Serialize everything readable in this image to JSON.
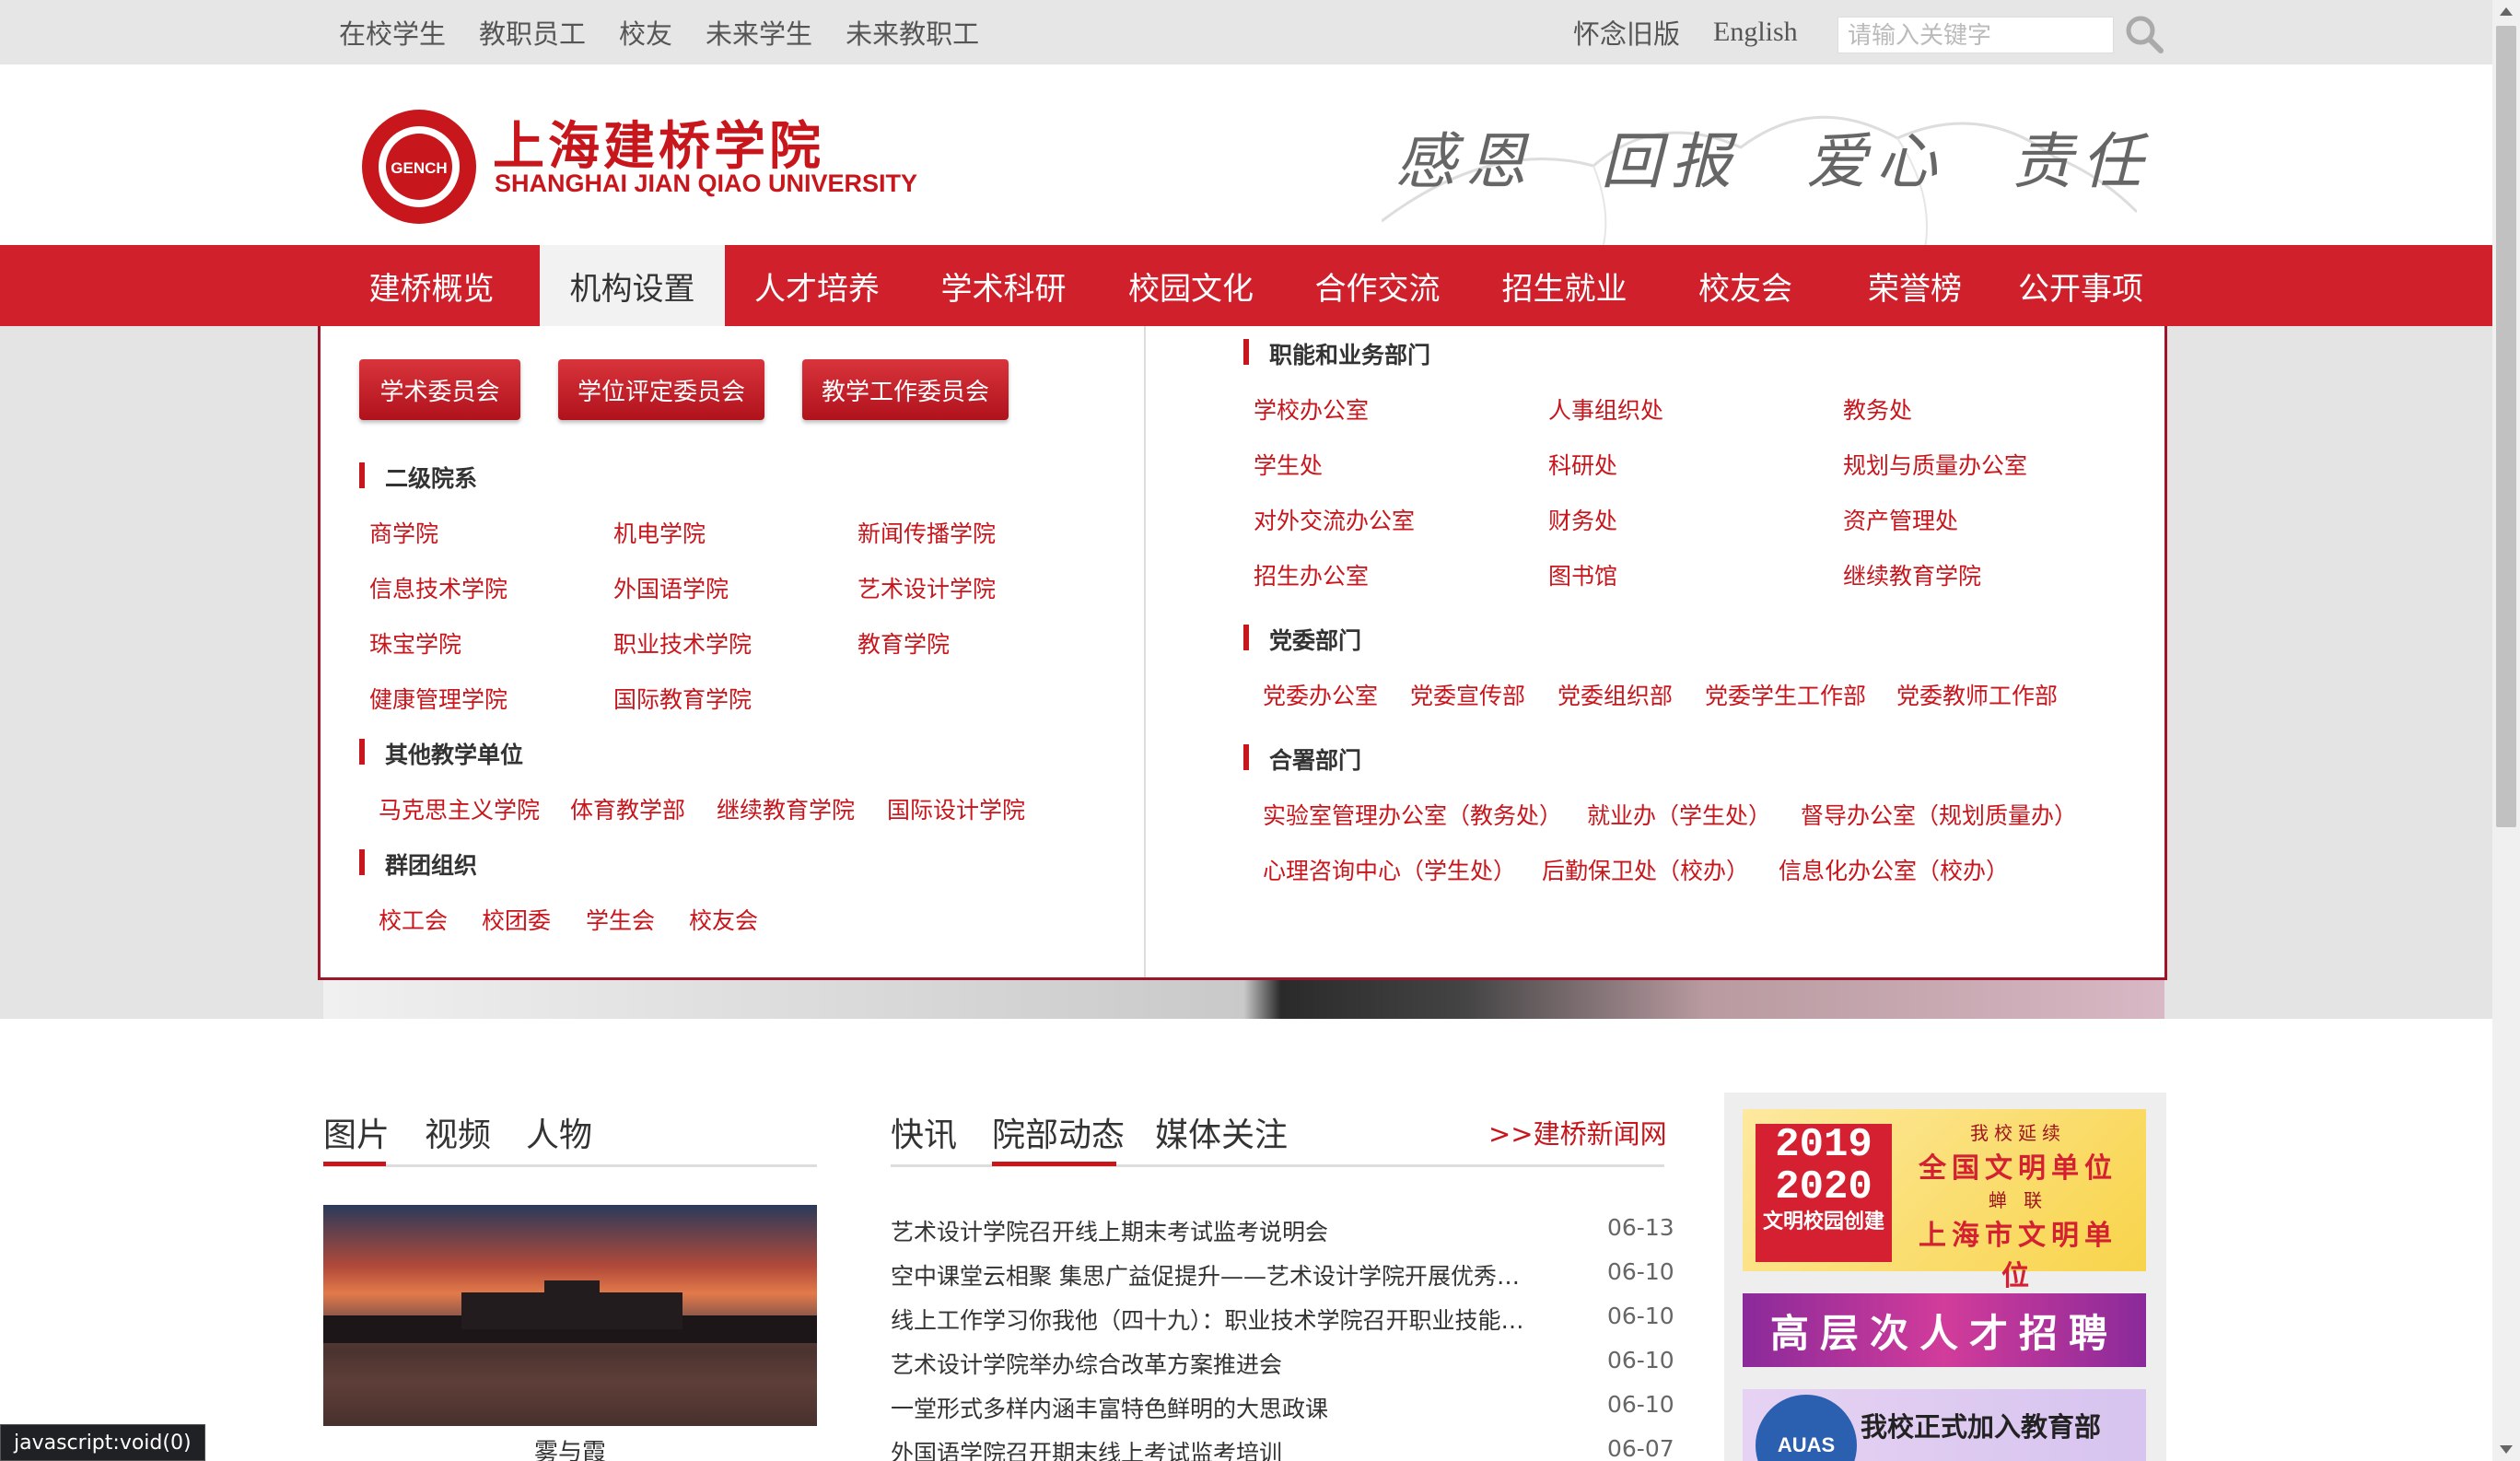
{
  "topbar": {
    "links": [
      "在校学生",
      "教职员工",
      "校友",
      "未来学生",
      "未来教职工"
    ],
    "old_version": "怀念旧版",
    "english": "English",
    "search_placeholder": "请输入关键字"
  },
  "header": {
    "logo_text": "GENCH",
    "cn_name": "上海建桥学院",
    "en_name": "SHANGHAI JIAN QIAO UNIVERSITY",
    "slogan": "感恩 回报 爱心 责任"
  },
  "nav": {
    "items": [
      "建桥概览",
      "机构设置",
      "人才培养",
      "学术科研",
      "校园文化",
      "合作交流",
      "招生就业",
      "校友会",
      "荣誉榜",
      "公开事项"
    ],
    "active": "机构设置"
  },
  "dropdown": {
    "buttons": [
      "学术委员会",
      "学位评定委员会",
      "教学工作委员会"
    ],
    "schools_title": "二级院系",
    "schools": [
      "商学院",
      "机电学院",
      "新闻传播学院",
      "信息技术学院",
      "外国语学院",
      "艺术设计学院",
      "珠宝学院",
      "职业技术学院",
      "教育学院",
      "健康管理学院",
      "国际教育学院"
    ],
    "other_title": "其他教学单位",
    "other": [
      "马克思主义学院",
      "体育教学部",
      "继续教育学院",
      "国际设计学院"
    ],
    "groups_title": "群团组织",
    "groups": [
      "校工会",
      "校团委",
      "学生会",
      "校友会"
    ],
    "functional_title": "职能和业务部门",
    "functional": [
      "学校办公室",
      "人事组织处",
      "教务处",
      "学生处",
      "科研处",
      "规划与质量办公室",
      "对外交流办公室",
      "财务处",
      "资产管理处",
      "招生办公室",
      "图书馆",
      "继续教育学院"
    ],
    "party_title": "党委部门",
    "party": [
      "党委办公室",
      "党委宣传部",
      "党委组织部",
      "党委学生工作部",
      "党委教师工作部"
    ],
    "joint_title": "合署部门",
    "joint": [
      "实验室管理办公室（教务处）",
      "就业办（学生处）",
      "督导办公室（规划质量办）",
      "心理咨询中心（学生处）",
      "后勤保卫处（校办）",
      "信息化办公室（校办）"
    ]
  },
  "media": {
    "tabs": [
      "图片",
      "视频",
      "人物"
    ],
    "caption": "雾与霞"
  },
  "news": {
    "tabs": [
      "快讯",
      "院部动态",
      "媒体关注"
    ],
    "more": ">>建桥新闻网",
    "items": [
      {
        "title": "艺术设计学院召开线上期末考试监考说明会",
        "date": "06-13"
      },
      {
        "title": "空中课堂云相聚 集思广益促提升——艺术设计学院开展优秀线上教学经验分享",
        "date": "06-10"
      },
      {
        "title": "线上工作学习你我他（四十九）：职业技术学院召开职业技能等级证书工作会议",
        "date": "06-10"
      },
      {
        "title": "艺术设计学院举办综合改革方案推进会",
        "date": "06-10"
      },
      {
        "title": "一堂形式多样内涵丰富特色鲜明的大思政课",
        "date": "06-10"
      },
      {
        "title": "外国语学院召开期末线上考试监考培训",
        "date": "06-07"
      }
    ]
  },
  "banners": {
    "b1_years": "2019\n2020",
    "b1_small": "文明校园创建",
    "b1_line1": "我校延续",
    "b1_line2": "全国文明单位",
    "b1_line3": "蝉 联",
    "b1_line4": "上海市文明单位",
    "b2": "高层次人才招聘",
    "b3_badge": "AUAS",
    "b3_text": "我校正式加入教育部"
  },
  "status": "javascript:void(0)",
  "colors": {
    "brand_red": "#d0202c",
    "text_red": "#c8161d"
  }
}
